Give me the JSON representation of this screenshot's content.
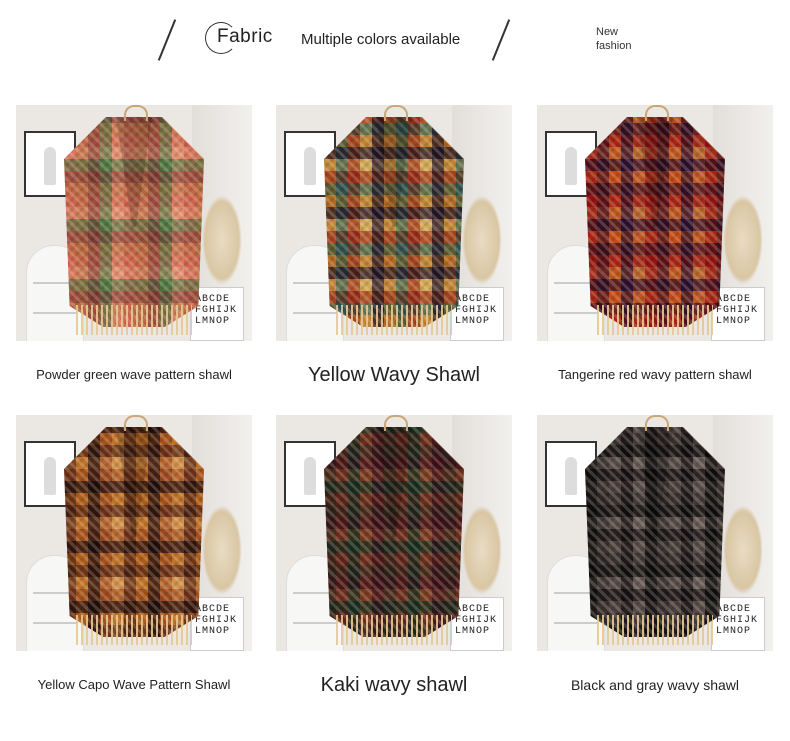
{
  "header": {
    "fabric_label": "Fabric",
    "tagline": "Multiple colors available",
    "new_line1": "New",
    "new_line2": "fashion"
  },
  "products": [
    {
      "caption": "Powder green wave pattern shawl",
      "colors": [
        "#e6a08a",
        "#d9a37c",
        "#b27a6e",
        "#8fae7f",
        "#f1c0a8"
      ]
    },
    {
      "caption": "Yellow Wavy Shawl",
      "colors": [
        "#d6a35a",
        "#6f8f88",
        "#c46a4a",
        "#e8cf92",
        "#5e4a5a"
      ]
    },
    {
      "caption": "Tangerine red wavy pattern shawl",
      "colors": [
        "#c2453c",
        "#7d3a4f",
        "#e08a4a",
        "#6a3d6b",
        "#d9a06a"
      ]
    },
    {
      "caption": "Yellow Capo Wave Pattern Shawl",
      "colors": [
        "#8a5a3c",
        "#d49a4a",
        "#5c3b2c",
        "#c98856",
        "#e8c088"
      ]
    },
    {
      "caption": "Kaki wavy shawl",
      "colors": [
        "#6d5a4a",
        "#9c5f4a",
        "#4e6a55",
        "#b07a58",
        "#7d3f4a"
      ]
    },
    {
      "caption": "Black and gray wavy shawl",
      "colors": [
        "#3b3635",
        "#6b6360",
        "#8a7f7a",
        "#4a3f3f",
        "#a09690"
      ]
    }
  ],
  "abc_box": {
    "line1": "ABCDE",
    "line2": "FGHIJK",
    "line3": "LMNOP"
  }
}
